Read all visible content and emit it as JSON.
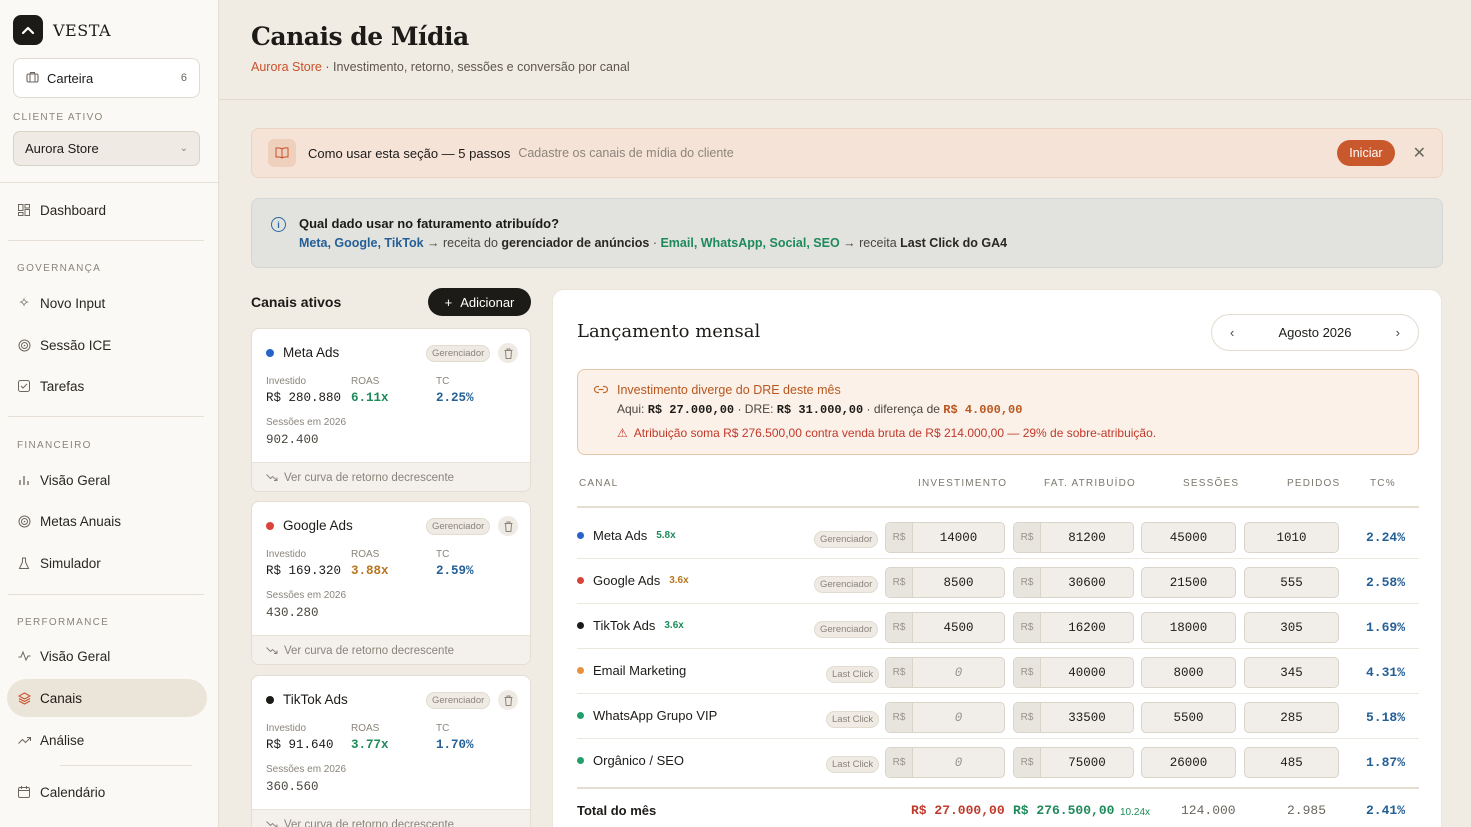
{
  "sidebar": {
    "brand": "VESTA",
    "carteira": {
      "label": "Carteira",
      "count": "6"
    },
    "cliente_label": "CLIENTE ATIVO",
    "cliente_value": "Aurora Store",
    "dashboard": "Dashboard",
    "sections": {
      "governanca": "GOVERNANÇA",
      "financeiro": "FINANCEIRO",
      "performance": "PERFORMANCE"
    },
    "items": {
      "novo_input": "Novo Input",
      "sessao_ice": "Sessão ICE",
      "tarefas": "Tarefas",
      "visao_geral_fin": "Visão Geral",
      "metas_anuais": "Metas Anuais",
      "simulador": "Simulador",
      "visao_geral_perf": "Visão Geral",
      "canais": "Canais",
      "analise": "Análise",
      "calendario": "Calendário"
    }
  },
  "header": {
    "title": "Canais de Mídia",
    "store": "Aurora Store",
    "subtitle": " · Investimento, retorno, sessões e conversão por canal"
  },
  "banner": {
    "title": "Como usar esta seção — 5 passos",
    "desc": "Cadastre os canais de mídia do cliente",
    "button": "Iniciar",
    "close": "✕"
  },
  "info": {
    "title": "Qual dado usar no faturamento atribuído?",
    "ads_channels": "Meta, Google, TikTok",
    "arrow1": " → receita do ",
    "ads_source": "gerenciador de anúncios",
    "sep": " · ",
    "organic_channels": "Email, WhatsApp, Social, SEO",
    "arrow2": " → receita ",
    "organic_source": "Last Click do GA4"
  },
  "channels": {
    "title": "Canais ativos",
    "add_button": "Adicionar",
    "labels": {
      "invested": "Investido",
      "roas": "ROAS",
      "tc": "TC",
      "sessions": "Sessões em 2026",
      "curve": "Ver curva de retorno decrescente"
    },
    "cards": [
      {
        "name": "Meta Ads",
        "color": "#2563c9",
        "tag": "Gerenciador",
        "invested": "R$ 280.880",
        "roas": "6.11x",
        "roas_color": "#1e8a5a",
        "tc": "2.25%",
        "sessions": "902.400"
      },
      {
        "name": "Google Ads",
        "color": "#d9443a",
        "tag": "Gerenciador",
        "invested": "R$ 169.320",
        "roas": "3.88x",
        "roas_color": "#b8761f",
        "tc": "2.59%",
        "sessions": "430.280"
      },
      {
        "name": "TikTok Ads",
        "color": "#1d1b18",
        "tag": "Gerenciador",
        "invested": "R$ 91.640",
        "roas": "3.77x",
        "roas_color": "#1e8a5a",
        "tc": "1.70%",
        "sessions": "360.560"
      }
    ]
  },
  "panel": {
    "title": "Lançamento mensal",
    "month": "Agosto 2026",
    "alert": {
      "title": "Investimento diverge do DRE deste mês",
      "aqui_label": "Aqui: ",
      "aqui_value": "R$ 27.000,00",
      "dre_label": " · DRE: ",
      "dre_value": "R$ 31.000,00",
      "diff_label": " · diferença de ",
      "diff_value": "R$ 4.000,00",
      "warning": "Atribuição soma R$ 276.500,00 contra venda bruta de R$ 214.000,00 — 29% de sobre-atribuição."
    },
    "columns": {
      "canal": "CANAL",
      "investimento": "INVESTIMENTO",
      "fat": "FAT. ATRIBUÍDO",
      "sessoes": "SESSÕES",
      "pedidos": "PEDIDOS",
      "tc": "TC%"
    },
    "currency": "R$",
    "rows": [
      {
        "name": "Meta Ads",
        "color": "#2563c9",
        "roas": "5.8x",
        "roas_color": "#1e8a5a",
        "tag": "Gerenciador",
        "invest": "14000",
        "fat": "81200",
        "sessions": "45000",
        "orders": "1010",
        "tc": "2.24%"
      },
      {
        "name": "Google Ads",
        "color": "#d9443a",
        "roas": "3.6x",
        "roas_color": "#b8761f",
        "tag": "Gerenciador",
        "invest": "8500",
        "fat": "30600",
        "sessions": "21500",
        "orders": "555",
        "tc": "2.58%"
      },
      {
        "name": "TikTok Ads",
        "color": "#1d1b18",
        "roas": "3.6x",
        "roas_color": "#1e8a5a",
        "tag": "Gerenciador",
        "invest": "4500",
        "fat": "16200",
        "sessions": "18000",
        "orders": "305",
        "tc": "1.69%"
      },
      {
        "name": "Email Marketing",
        "color": "#e8913a",
        "roas": "",
        "roas_color": "#1e8a5a",
        "tag": "Last Click",
        "invest": "0",
        "fat": "40000",
        "sessions": "8000",
        "orders": "345",
        "tc": "4.31%"
      },
      {
        "name": "WhatsApp Grupo VIP",
        "color": "#22a06b",
        "roas": "",
        "roas_color": "#1e8a5a",
        "tag": "Last Click",
        "invest": "0",
        "fat": "33500",
        "sessions": "5500",
        "orders": "285",
        "tc": "5.18%"
      },
      {
        "name": "Orgânico / SEO",
        "color": "#22a06b",
        "roas": "",
        "roas_color": "#1e8a5a",
        "tag": "Last Click",
        "invest": "0",
        "fat": "75000",
        "sessions": "26000",
        "orders": "485",
        "tc": "1.87%"
      }
    ],
    "total": {
      "label": "Total do mês",
      "invest": "R$ 27.000,00",
      "fat": "R$ 276.500,00",
      "roas": "10.24x",
      "sessions": "124.000",
      "orders": "2.985",
      "tc": "2.41%"
    }
  }
}
